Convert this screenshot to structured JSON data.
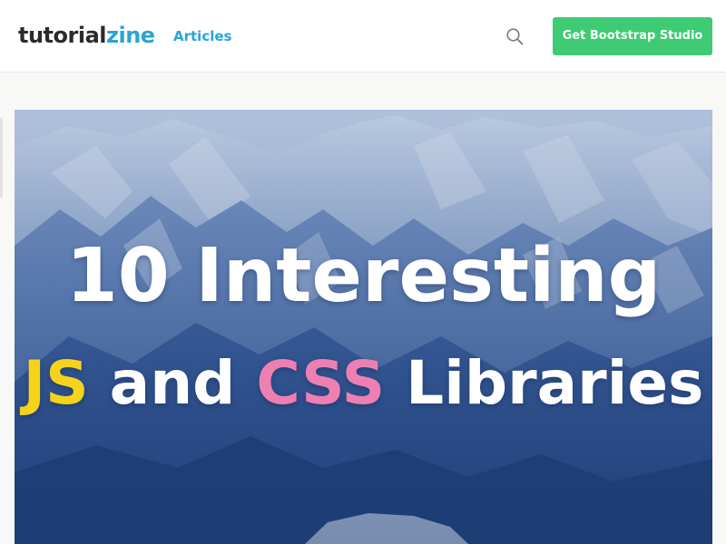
{
  "header": {
    "logo": {
      "part1": "tutorial",
      "part2": "zine"
    },
    "nav": [
      {
        "label": "Articles"
      }
    ],
    "search_icon": "search-icon",
    "cta_label": "Get Bootstrap Studio"
  },
  "hero": {
    "title_line1": "10 Interesting",
    "title_line2": {
      "word1": "JS",
      "word2": "and",
      "word3": "CSS",
      "word4": "Libraries"
    }
  },
  "colors": {
    "brand_blue": "#2aa3d8",
    "cta_green": "#3ecb73",
    "js_yellow": "#f6d31b",
    "css_pink": "#ee7fb3"
  }
}
